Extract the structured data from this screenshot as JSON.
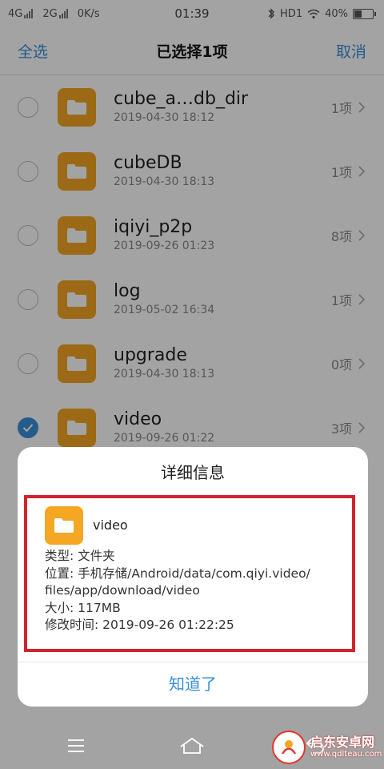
{
  "status_bar": {
    "net1": "4G",
    "net2": "2G",
    "speed": "0K/s",
    "time": "01:39",
    "hd": "HD1",
    "battery": "40%"
  },
  "title_bar": {
    "select_all": "全选",
    "title": "已选择1项",
    "cancel": "取消"
  },
  "files": [
    {
      "name": "cube_a…db_dir",
      "date": "2019-04-30 18:12",
      "count": "1项",
      "checked": false
    },
    {
      "name": "cubeDB",
      "date": "2019-04-30 18:13",
      "count": "1项",
      "checked": false
    },
    {
      "name": "iqiyi_p2p",
      "date": "2019-09-26 01:23",
      "count": "8项",
      "checked": false
    },
    {
      "name": "log",
      "date": "2019-05-02 16:34",
      "count": "1项",
      "checked": false
    },
    {
      "name": "upgrade",
      "date": "2019-04-30 18:13",
      "count": "0项",
      "checked": false
    },
    {
      "name": "video",
      "date": "2019-09-26 01:22",
      "count": "3项",
      "checked": true
    }
  ],
  "dialog": {
    "title": "详细信息",
    "file_name": "video",
    "type_line": "类型: 文件夹",
    "location_line1": "位置: 手机存储/Android/data/com.qiyi.video/",
    "location_line2": "files/app/download/video",
    "size_line": "大小: 117MB",
    "modified_line": "修改时间: 2019-09-26 01:22:25",
    "ok_button": "知道了"
  },
  "watermark": {
    "brand": "启东安卓网",
    "url": "www.qdlteau.com"
  },
  "colors": {
    "accent": "#3a8fd9",
    "folder": "#f5a623",
    "highlight_box": "#d0232d"
  }
}
